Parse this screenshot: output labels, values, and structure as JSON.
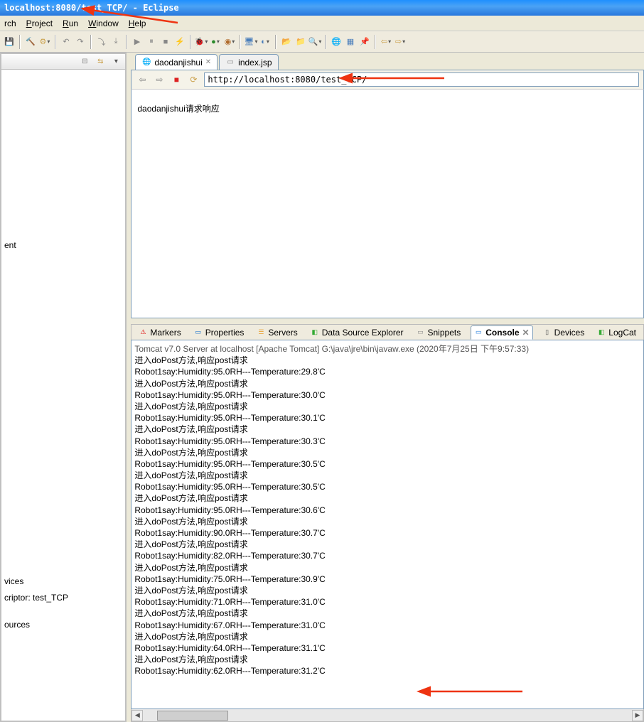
{
  "title": "localhost:8080/test_TCP/ - Eclipse",
  "menu": {
    "rch": "rch",
    "project": "Project",
    "run": "Run",
    "window": "Window",
    "help": "Help"
  },
  "editor_tabs": [
    {
      "label": "daodanjishui",
      "active": true,
      "icon": "globe",
      "closable": true
    },
    {
      "label": "index.jsp",
      "active": false,
      "icon": "file",
      "closable": false
    }
  ],
  "browser": {
    "url": "http://localhost:8080/test_TCP/",
    "body": "daodanjishui请求响应"
  },
  "left_items": {
    "ent": "ent",
    "vices": "vices",
    "criptor": "criptor: test_TCP",
    "ources": "ources"
  },
  "bottom_tabs": [
    {
      "label": "Markers",
      "icon": "⚠",
      "color": "#d00"
    },
    {
      "label": "Properties",
      "icon": "▭",
      "color": "#06c"
    },
    {
      "label": "Servers",
      "icon": "☰",
      "color": "#e8a43a",
      "boldlike": true
    },
    {
      "label": "Data Source Explorer",
      "icon": "◧",
      "color": "#3a3"
    },
    {
      "label": "Snippets",
      "icon": "▭",
      "color": "#888"
    },
    {
      "label": "Console",
      "icon": "▭",
      "color": "#6aa7e8",
      "active": true
    },
    {
      "label": "Devices",
      "icon": "▯",
      "color": "#555"
    },
    {
      "label": "LogCat",
      "icon": "◧",
      "color": "#3a3"
    }
  ],
  "console": {
    "header": "Tomcat v7.0 Server at localhost [Apache Tomcat] G:\\java\\jre\\bin\\javaw.exe (2020年7月25日 下午9:57:33)",
    "lines": [
      "进入doPost方法,响应post请求",
      "Robot1say:Humidity:95.0RH---Temperature:29.8'C",
      "进入doPost方法,响应post请求",
      "Robot1say:Humidity:95.0RH---Temperature:30.0'C",
      "进入doPost方法,响应post请求",
      "Robot1say:Humidity:95.0RH---Temperature:30.1'C",
      "进入doPost方法,响应post请求",
      "Robot1say:Humidity:95.0RH---Temperature:30.3'C",
      "进入doPost方法,响应post请求",
      "Robot1say:Humidity:95.0RH---Temperature:30.5'C",
      "进入doPost方法,响应post请求",
      "Robot1say:Humidity:95.0RH---Temperature:30.5'C",
      "进入doPost方法,响应post请求",
      "Robot1say:Humidity:95.0RH---Temperature:30.6'C",
      "进入doPost方法,响应post请求",
      "Robot1say:Humidity:90.0RH---Temperature:30.7'C",
      "进入doPost方法,响应post请求",
      "Robot1say:Humidity:82.0RH---Temperature:30.7'C",
      "进入doPost方法,响应post请求",
      "Robot1say:Humidity:75.0RH---Temperature:30.9'C",
      "进入doPost方法,响应post请求",
      "Robot1say:Humidity:71.0RH---Temperature:31.0'C",
      "进入doPost方法,响应post请求",
      "Robot1say:Humidity:67.0RH---Temperature:31.0'C",
      "进入doPost方法,响应post请求",
      "Robot1say:Humidity:64.0RH---Temperature:31.1'C",
      "进入doPost方法,响应post请求",
      "Robot1say:Humidity:62.0RH---Temperature:31.2'C"
    ]
  }
}
